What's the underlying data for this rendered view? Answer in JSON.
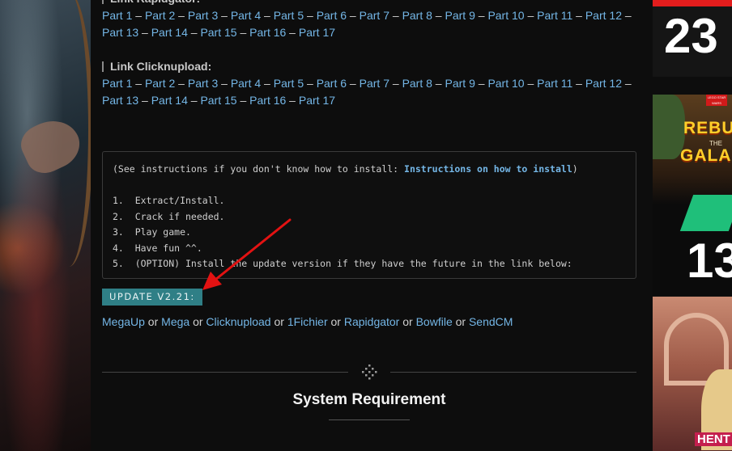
{
  "rapidgator": {
    "heading": "Link Rapidgator:",
    "parts": [
      "Part 1",
      "Part 2",
      "Part 3",
      "Part 4",
      "Part 5",
      "Part 6",
      "Part 7",
      "Part 8",
      "Part 9",
      "Part 10",
      "Part 11",
      "Part 12",
      "Part 13",
      "Part 14",
      "Part 15",
      "Part 16",
      "Part 17"
    ]
  },
  "clicknupload": {
    "heading": "Link Clicknupload:",
    "parts": [
      "Part 1",
      "Part 2",
      "Part 3",
      "Part 4",
      "Part 5",
      "Part 6",
      "Part 7",
      "Part 8",
      "Part 9",
      "Part 10",
      "Part 11",
      "Part 12",
      "Part 13",
      "Part 14",
      "Part 15",
      "Part 16",
      "Part 17"
    ]
  },
  "dash": "–",
  "instructions": {
    "intro_prefix": "(See instructions if you don't know how to install: ",
    "intro_link": "Instructions on how to install",
    "intro_suffix": ")",
    "steps": [
      "1.  Extract/Install.",
      "2.  Crack if needed.",
      "3.  Play game.",
      "4.  Have fun ^^.",
      "5.  (OPTION) Install the update version if they have the future in the link below:"
    ]
  },
  "update": {
    "label": "UPDATE V2.21:"
  },
  "mirrors": {
    "separator": "or",
    "links": [
      "MegaUp",
      "Mega",
      "Clicknupload",
      "1Fichier",
      "Rapidgator",
      "Bowfile",
      "SendCM"
    ]
  },
  "divider_icon": "diamond-dots-icon",
  "system_requirement": {
    "title": "System Requirement"
  },
  "sidebar": {
    "thumb1_number": "23",
    "thumb2_brand": "LEGO STAR WARS",
    "thumb2_title_top": "REBU",
    "thumb2_title_mid": "THE",
    "thumb2_title_bottom": "GALAX",
    "thumb2_number": "13",
    "thumb3_label": "HENT"
  },
  "colors": {
    "link": "#74b6e6",
    "update_button": "#2f7f86",
    "arrow": "#e31212",
    "background": "#0d0d0d"
  }
}
